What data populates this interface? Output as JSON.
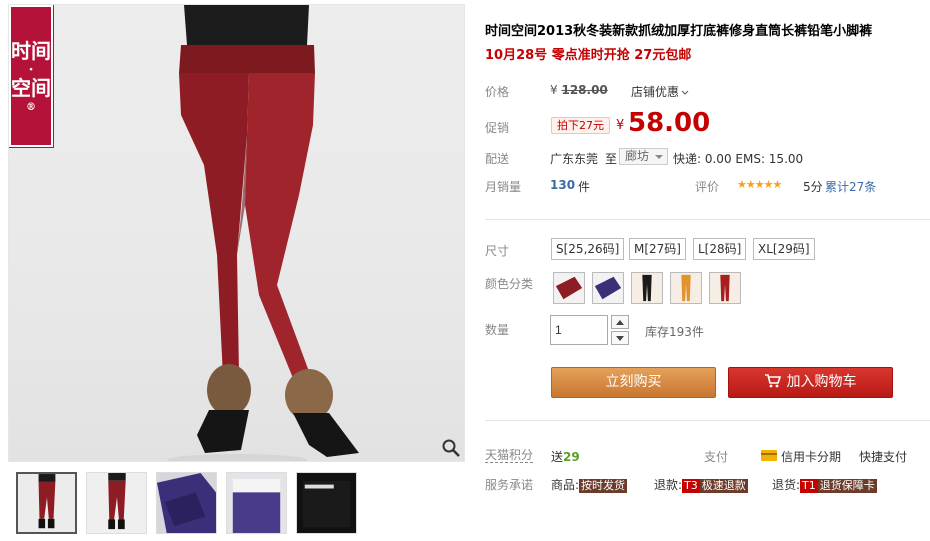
{
  "brand_logo": {
    "text": "时间·空间",
    "line1": "时间",
    "dot": "·",
    "line2": "空间",
    "reg": "®"
  },
  "product": {
    "title": "时间空间2013秋冬装新款抓绒加厚打底裤修身直筒长裤铅笔小脚裤",
    "subtitle": "10月28号 零点准时开抢 27元包邮"
  },
  "price": {
    "label": "价格",
    "original_currency": "¥",
    "original": "128.00",
    "shop_discount": "店铺优惠",
    "promo_label": "促销",
    "promo_tag": "拍下27元",
    "currency": "¥",
    "current": "58.00"
  },
  "shipping": {
    "label": "配送",
    "from": "广东东莞",
    "to_word": "至",
    "destination": "廊坊",
    "fee": "快递: 0.00 EMS: 15.00"
  },
  "sales": {
    "label": "月销量",
    "count": "130",
    "unit": "件",
    "rating_label": "评价",
    "stars": "★★★★★",
    "score": "5分",
    "reviews": "累计27条"
  },
  "sizes": {
    "label": "尺寸",
    "options": [
      "S[25,26码]",
      "M[27码]",
      "L[28码]",
      "XL[29码]"
    ]
  },
  "colors": {
    "label": "颜色分类",
    "swatches": [
      {
        "name": "wine",
        "color": "#8e1c24"
      },
      {
        "name": "purple",
        "color": "#3b2f7a"
      },
      {
        "name": "black",
        "color": "#1a1a1a"
      },
      {
        "name": "orange",
        "color": "#e2942c"
      },
      {
        "name": "red",
        "color": "#a61e1e"
      }
    ]
  },
  "quantity": {
    "label": "数量",
    "value": "1",
    "stock": "库存193件"
  },
  "actions": {
    "buy_now": "立刻购买",
    "add_to_cart": "加入购物车"
  },
  "points": {
    "label": "天猫积分",
    "give": "送",
    "value": "29"
  },
  "payment": {
    "label": "支付",
    "credit": "信用卡分期",
    "quick": "快捷支付"
  },
  "service": {
    "label": "服务承诺",
    "goods_prefix": "商品:",
    "goods_tag": "按时发货",
    "refund_prefix": "退款:",
    "refund_code": "T3",
    "refund_tag": "极速退款",
    "return_prefix": "退货:",
    "return_code": "T1",
    "return_tag": "退货保障卡"
  },
  "gallery": {
    "thumbnail_count": 5,
    "thumbnail_colors": [
      "#8e1c24",
      "#8e1c24",
      "#3b2f7a",
      "#4a3b8a",
      "#1a1a1a"
    ]
  }
}
